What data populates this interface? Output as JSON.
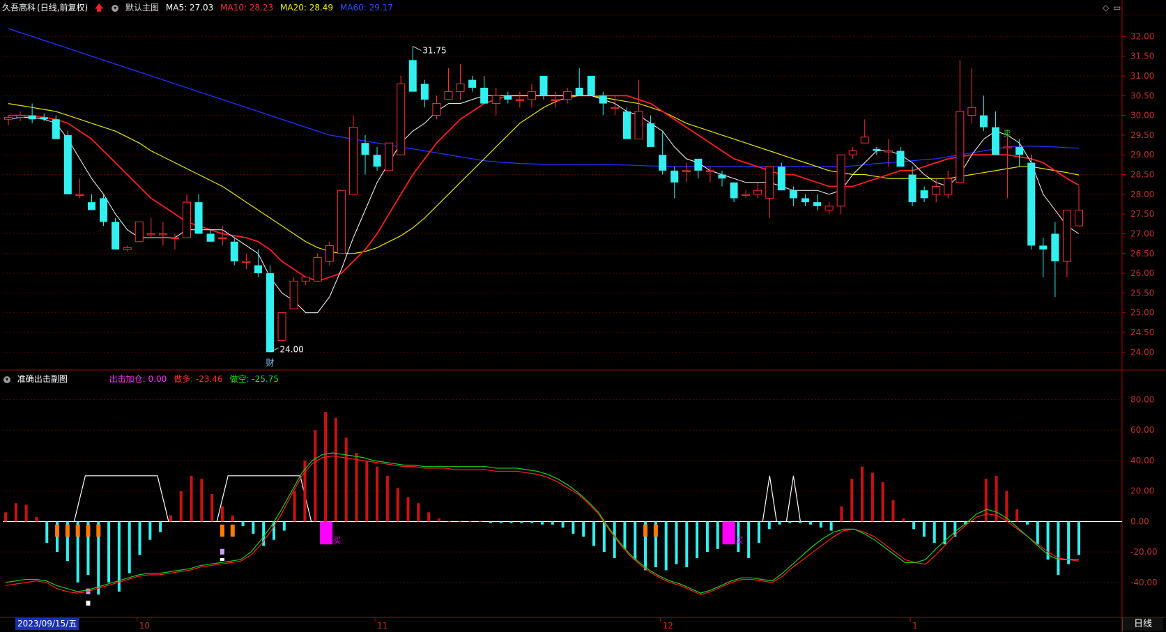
{
  "header": {
    "stock_name": "久吾高科",
    "mode": "(日线,前复权)",
    "template": "默认主图",
    "ma5": "MA5: 27.03",
    "ma10": "MA10: 28.23",
    "ma20": "MA20: 28.49",
    "ma60": "MA60: 29.17"
  },
  "sub_header": {
    "indicator": "准确出击副图",
    "v1": "出击加仓: 0.00",
    "v2": "做多: -23.46",
    "v3": "做空: -25.75"
  },
  "footer": {
    "cursor_date": "2023/09/15/五",
    "period_tab": "日线"
  },
  "colors": {
    "up": "#ff3333",
    "down": "#33f0f0",
    "ma5": "#ffffff",
    "ma10": "#ff2020",
    "ma20": "#e8e800",
    "ma60": "#2233ff",
    "grid": "#5a0000",
    "axis": "#b00000",
    "buy": "#ff00ff",
    "sub_green": "#20d020",
    "sub_red": "#ff2020"
  },
  "chart_data": [
    {
      "type": "candlestick",
      "title": "久吾高科",
      "ylim": [
        23.6,
        32.5
      ],
      "y_ticks": [
        "32.00",
        "31.50",
        "31.00",
        "30.50",
        "30.00",
        "29.50",
        "29.00",
        "28.50",
        "28.00",
        "27.50",
        "27.00",
        "26.50",
        "26.00",
        "25.50",
        "25.00",
        "24.50",
        "24.00"
      ],
      "x_tick_labels": [
        "10",
        "11",
        "12",
        "1"
      ],
      "annotations": {
        "high_label": "31.75",
        "low_label": "24.00",
        "finance_tag": "财",
        "sell_tag": "卖"
      },
      "ohlc": [
        [
          29.9,
          30.0,
          29.75,
          29.95
        ],
        [
          29.95,
          30.1,
          29.85,
          30.0
        ],
        [
          30.0,
          30.3,
          29.8,
          29.9
        ],
        [
          29.95,
          30.05,
          29.85,
          29.9
        ],
        [
          29.9,
          30.0,
          29.4,
          29.4
        ],
        [
          29.5,
          29.6,
          28.0,
          28.0
        ],
        [
          28.0,
          28.4,
          27.9,
          28.0
        ],
        [
          27.8,
          28.0,
          27.6,
          27.6
        ],
        [
          27.9,
          28.0,
          27.2,
          27.3
        ],
        [
          27.3,
          27.4,
          26.6,
          26.6
        ],
        [
          26.6,
          26.7,
          26.55,
          26.65
        ],
        [
          26.8,
          27.3,
          26.9,
          27.3
        ],
        [
          27.0,
          27.4,
          26.9,
          27.0
        ],
        [
          27.0,
          27.3,
          26.7,
          27.0
        ],
        [
          26.9,
          27.0,
          26.6,
          26.9
        ],
        [
          26.9,
          28.0,
          26.9,
          27.8
        ],
        [
          27.8,
          28.0,
          27.0,
          27.0
        ],
        [
          27.0,
          27.1,
          26.8,
          26.8
        ],
        [
          26.9,
          27.2,
          26.7,
          26.9
        ],
        [
          26.8,
          26.9,
          26.2,
          26.3
        ],
        [
          26.3,
          26.5,
          26.1,
          26.3
        ],
        [
          26.2,
          26.6,
          25.9,
          26.0
        ],
        [
          26.0,
          26.2,
          24.0,
          24.0
        ],
        [
          24.3,
          25.0,
          24.3,
          25.0
        ],
        [
          25.1,
          25.9,
          25.1,
          25.8
        ],
        [
          25.8,
          25.9,
          25.7,
          25.9
        ],
        [
          25.8,
          26.5,
          25.8,
          26.4
        ],
        [
          26.3,
          26.8,
          26.2,
          26.7
        ],
        [
          26.5,
          28.1,
          26.5,
          28.1
        ],
        [
          28.0,
          30.0,
          28.0,
          29.7
        ],
        [
          29.3,
          29.5,
          28.5,
          29.0
        ],
        [
          29.0,
          29.2,
          28.6,
          28.7
        ],
        [
          28.6,
          29.3,
          28.6,
          29.3
        ],
        [
          29.0,
          31.0,
          29.0,
          30.8
        ],
        [
          31.4,
          31.75,
          30.6,
          30.6
        ],
        [
          30.8,
          30.9,
          30.2,
          30.4
        ],
        [
          30.0,
          30.5,
          29.9,
          30.3
        ],
        [
          30.4,
          31.2,
          30.4,
          30.6
        ],
        [
          30.6,
          31.3,
          30.4,
          30.8
        ],
        [
          30.9,
          31.0,
          30.6,
          30.7
        ],
        [
          30.7,
          31.0,
          30.3,
          30.3
        ],
        [
          30.3,
          30.7,
          30.0,
          30.5
        ],
        [
          30.5,
          30.6,
          30.3,
          30.4
        ],
        [
          30.4,
          30.6,
          30.2,
          30.4
        ],
        [
          30.4,
          30.8,
          30.2,
          30.6
        ],
        [
          31.0,
          31.0,
          30.4,
          30.5
        ],
        [
          30.4,
          30.6,
          30.2,
          30.4
        ],
        [
          30.4,
          30.7,
          30.3,
          30.6
        ],
        [
          30.7,
          31.2,
          30.5,
          30.5
        ],
        [
          31.0,
          31.0,
          30.5,
          30.5
        ],
        [
          30.5,
          30.6,
          30.0,
          30.3
        ],
        [
          30.2,
          30.5,
          30.0,
          30.2
        ],
        [
          30.1,
          30.2,
          29.4,
          29.4
        ],
        [
          29.4,
          30.9,
          29.4,
          30.1
        ],
        [
          29.8,
          30.0,
          29.2,
          29.2
        ],
        [
          29.0,
          29.6,
          28.5,
          28.6
        ],
        [
          28.6,
          28.7,
          27.9,
          28.3
        ],
        [
          28.6,
          28.8,
          28.3,
          28.6
        ],
        [
          28.9,
          28.9,
          28.4,
          28.6
        ],
        [
          28.6,
          28.7,
          28.3,
          28.6
        ],
        [
          28.5,
          28.6,
          28.2,
          28.4
        ],
        [
          28.3,
          28.3,
          27.8,
          27.9
        ],
        [
          28.0,
          28.1,
          27.9,
          28.0
        ],
        [
          28.0,
          28.3,
          27.9,
          28.1
        ],
        [
          27.9,
          28.7,
          27.4,
          28.7
        ],
        [
          28.7,
          28.8,
          28.1,
          28.1
        ],
        [
          28.1,
          28.2,
          27.7,
          27.9
        ],
        [
          27.9,
          28.0,
          27.7,
          27.8
        ],
        [
          27.8,
          28.0,
          27.6,
          27.7
        ],
        [
          27.6,
          27.8,
          27.5,
          27.7
        ],
        [
          27.7,
          29.0,
          27.5,
          29.0
        ],
        [
          29.0,
          29.2,
          28.9,
          29.1
        ],
        [
          29.3,
          29.9,
          29.3,
          29.45
        ],
        [
          29.15,
          29.2,
          29.0,
          29.1
        ],
        [
          29.1,
          29.4,
          28.7,
          29.1
        ],
        [
          29.1,
          29.2,
          28.7,
          28.7
        ],
        [
          28.5,
          28.7,
          27.7,
          27.8
        ],
        [
          28.1,
          28.2,
          27.8,
          27.9
        ],
        [
          28.0,
          28.4,
          27.8,
          28.2
        ],
        [
          28.0,
          28.6,
          27.9,
          28.4
        ],
        [
          28.3,
          31.4,
          28.3,
          30.1
        ],
        [
          30.0,
          31.2,
          29.8,
          30.2
        ],
        [
          30.0,
          30.5,
          29.6,
          29.7
        ],
        [
          29.7,
          30.1,
          29.0,
          29.0
        ],
        [
          29.2,
          29.5,
          27.9,
          29.2
        ],
        [
          29.2,
          29.4,
          28.7,
          29.0
        ],
        [
          28.8,
          29.0,
          26.6,
          26.7
        ],
        [
          26.7,
          26.9,
          25.9,
          26.6
        ],
        [
          27.0,
          27.3,
          25.4,
          26.3
        ],
        [
          26.3,
          27.6,
          25.9,
          27.6
        ],
        [
          27.2,
          28.2,
          27.2,
          27.6
        ]
      ],
      "ma5": [
        29.9,
        29.95,
        29.95,
        29.9,
        29.8,
        29.4,
        28.9,
        28.4,
        28.0,
        27.5,
        27.1,
        26.9,
        26.9,
        26.9,
        26.9,
        27.1,
        27.1,
        27.1,
        27.1,
        26.9,
        26.7,
        26.5,
        25.9,
        25.5,
        25.3,
        25.0,
        25.0,
        25.4,
        26.1,
        26.9,
        27.6,
        28.3,
        28.8,
        29.3,
        29.6,
        29.8,
        30.1,
        30.3,
        30.3,
        30.4,
        30.5,
        30.5,
        30.5,
        30.5,
        30.5,
        30.5,
        30.5,
        30.5,
        30.5,
        30.5,
        30.4,
        30.3,
        30.1,
        30.0,
        29.8,
        29.6,
        29.2,
        28.9,
        28.8,
        28.6,
        28.5,
        28.4,
        28.3,
        28.3,
        28.3,
        28.2,
        28.1,
        28.1,
        28.1,
        28.0,
        28.1,
        28.5,
        28.8,
        29.1,
        29.1,
        29.0,
        28.8,
        28.5,
        28.3,
        28.2,
        28.5,
        29.0,
        29.4,
        29.6,
        29.5,
        29.3,
        28.8,
        28.0,
        27.6,
        27.2,
        27.0
      ],
      "ma10": [
        30.0,
        30.0,
        29.98,
        29.95,
        29.9,
        29.8,
        29.6,
        29.4,
        29.1,
        28.8,
        28.5,
        28.2,
        27.9,
        27.7,
        27.5,
        27.3,
        27.2,
        27.1,
        27.0,
        26.95,
        26.9,
        26.8,
        26.6,
        26.3,
        26.1,
        25.9,
        25.8,
        25.9,
        26.0,
        26.3,
        26.6,
        27.0,
        27.5,
        28.0,
        28.5,
        28.9,
        29.3,
        29.6,
        29.9,
        30.1,
        30.3,
        30.4,
        30.5,
        30.5,
        30.5,
        30.5,
        30.5,
        30.5,
        30.5,
        30.5,
        30.5,
        30.5,
        30.5,
        30.4,
        30.3,
        30.1,
        29.9,
        29.7,
        29.5,
        29.3,
        29.1,
        28.9,
        28.8,
        28.7,
        28.6,
        28.5,
        28.5,
        28.4,
        28.3,
        28.2,
        28.2,
        28.2,
        28.3,
        28.4,
        28.5,
        28.6,
        28.6,
        28.7,
        28.8,
        28.9,
        28.95,
        29.0,
        29.0,
        29.0,
        29.0,
        28.95,
        28.9,
        28.8,
        28.6,
        28.4,
        28.23
      ],
      "ma20": [
        30.3,
        30.25,
        30.2,
        30.15,
        30.1,
        30.0,
        29.9,
        29.8,
        29.7,
        29.6,
        29.45,
        29.3,
        29.1,
        28.95,
        28.8,
        28.65,
        28.5,
        28.35,
        28.2,
        28.0,
        27.8,
        27.6,
        27.4,
        27.2,
        27.0,
        26.8,
        26.65,
        26.55,
        26.5,
        26.5,
        26.55,
        26.65,
        26.8,
        26.95,
        27.15,
        27.4,
        27.7,
        28.0,
        28.3,
        28.6,
        28.9,
        29.2,
        29.5,
        29.8,
        30.0,
        30.2,
        30.35,
        30.45,
        30.5,
        30.5,
        30.45,
        30.4,
        30.35,
        30.3,
        30.2,
        30.1,
        29.95,
        29.8,
        29.7,
        29.6,
        29.5,
        29.4,
        29.3,
        29.2,
        29.1,
        29.0,
        28.9,
        28.8,
        28.7,
        28.6,
        28.55,
        28.5,
        28.5,
        28.45,
        28.4,
        28.4,
        28.4,
        28.4,
        28.4,
        28.4,
        28.45,
        28.5,
        28.55,
        28.6,
        28.65,
        28.7,
        28.7,
        28.65,
        28.6,
        28.55,
        28.49
      ],
      "ma60": [
        32.2,
        32.1,
        32.0,
        31.9,
        31.8,
        31.7,
        31.6,
        31.5,
        31.4,
        31.3,
        31.2,
        31.1,
        31.0,
        30.9,
        30.8,
        30.7,
        30.6,
        30.5,
        30.4,
        30.3,
        30.2,
        30.1,
        30.0,
        29.9,
        29.8,
        29.7,
        29.6,
        29.5,
        29.45,
        29.4,
        29.35,
        29.3,
        29.25,
        29.2,
        29.15,
        29.1,
        29.05,
        29.0,
        28.95,
        28.9,
        28.85,
        28.82,
        28.8,
        28.78,
        28.77,
        28.76,
        28.76,
        28.76,
        28.76,
        28.76,
        28.76,
        28.75,
        28.74,
        28.73,
        28.72,
        28.71,
        28.7,
        28.7,
        28.7,
        28.7,
        28.7,
        28.7,
        28.7,
        28.7,
        28.7,
        28.7,
        28.7,
        28.7,
        28.7,
        28.7,
        28.7,
        28.72,
        28.75,
        28.78,
        28.8,
        28.82,
        28.85,
        28.88,
        28.9,
        28.95,
        29.0,
        29.05,
        29.1,
        29.15,
        29.2,
        29.22,
        29.22,
        29.21,
        29.2,
        29.18,
        29.17
      ]
    },
    {
      "type": "bar",
      "title": "准确出击副图",
      "ylim": [
        -62,
        88
      ],
      "y_ticks": [
        "80.00",
        "60.00",
        "40.00",
        "20.00",
        "0.00",
        "-20.00",
        "-40.00"
      ],
      "values": [
        6,
        12,
        11,
        3,
        -14,
        -20,
        -26,
        -40,
        -35,
        -48,
        -40,
        -46,
        -34,
        -22,
        -12,
        -7,
        4,
        20,
        30,
        28,
        18,
        10,
        4,
        -3,
        -8,
        -16,
        -12,
        -6,
        20,
        40,
        60,
        72,
        68,
        55,
        45,
        40,
        36,
        30,
        22,
        16,
        12,
        6,
        2,
        0,
        0,
        0,
        0,
        -1,
        -1,
        -1,
        -1,
        -1,
        -2,
        -2,
        -4,
        -8,
        -10,
        -16,
        -20,
        -24,
        -18,
        -25,
        -32,
        -30,
        -32,
        -28,
        -30,
        -24,
        -20,
        -18,
        -14,
        -20,
        -24,
        -14,
        -5,
        -2,
        -1,
        -1,
        -2,
        -4,
        -6,
        10,
        28,
        36,
        32,
        26,
        14,
        2,
        -5,
        -10,
        -14,
        -15,
        -10,
        -2,
        0,
        28,
        30,
        20,
        8,
        -2,
        -15,
        -25,
        -35,
        -28,
        -22
      ],
      "short_line": [
        -42,
        -41,
        -40,
        -39,
        -40,
        -44,
        -46,
        -47,
        -46,
        -44,
        -42,
        -40,
        -38,
        -36,
        -35,
        -35,
        -34,
        -33,
        -32,
        -30,
        -29,
        -28,
        -27,
        -26,
        -22,
        -15,
        -6,
        5,
        18,
        30,
        38,
        42,
        43,
        42,
        41,
        40,
        39,
        38,
        37,
        36,
        36,
        35,
        35,
        35,
        34,
        34,
        34,
        34,
        33,
        33,
        33,
        32,
        31,
        29,
        26,
        22,
        18,
        12,
        5,
        -5,
        -14,
        -22,
        -28,
        -33,
        -37,
        -40,
        -42,
        -45,
        -48,
        -46,
        -43,
        -40,
        -38,
        -38,
        -39,
        -40,
        -36,
        -30,
        -25,
        -20,
        -15,
        -10,
        -6,
        -5,
        -7,
        -10,
        -15,
        -20,
        -25,
        -27,
        -28,
        -22,
        -15,
        -8,
        -2,
        3,
        5,
        4,
        0,
        -5,
        -10,
        -15,
        -20,
        -24,
        -25,
        -26
      ],
      "long_line": [
        -40,
        -39,
        -38,
        -38,
        -39,
        -42,
        -44,
        -46,
        -45,
        -43,
        -41,
        -39,
        -37,
        -35,
        -34,
        -34,
        -33,
        -32,
        -31,
        -29,
        -28,
        -27,
        -26,
        -25,
        -20,
        -12,
        -3,
        8,
        20,
        32,
        40,
        44,
        45,
        44,
        43,
        42,
        40,
        39,
        38,
        37,
        37,
        36,
        36,
        36,
        36,
        36,
        36,
        36,
        35,
        35,
        35,
        34,
        33,
        31,
        28,
        24,
        19,
        13,
        6,
        -4,
        -13,
        -21,
        -27,
        -32,
        -36,
        -39,
        -41,
        -44,
        -47,
        -45,
        -42,
        -39,
        -37,
        -37,
        -38,
        -39,
        -34,
        -28,
        -22,
        -16,
        -11,
        -7,
        -5,
        -5,
        -8,
        -12,
        -17,
        -22,
        -27,
        -27,
        -25,
        -18,
        -12,
        -6,
        -1,
        5,
        8,
        6,
        2,
        -4,
        -10,
        -16,
        -22,
        -25,
        -25,
        -25
      ],
      "sell_tag": "卖",
      "buy_tag": "买"
    }
  ]
}
